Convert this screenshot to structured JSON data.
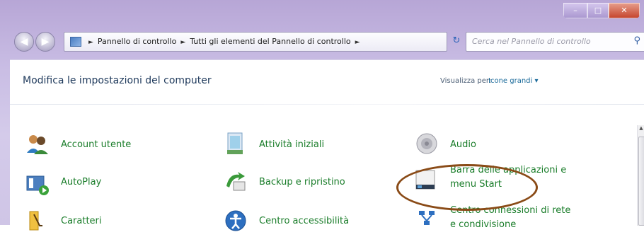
{
  "window": {
    "controls": {
      "min": "–",
      "max": "□",
      "close": "✕"
    }
  },
  "navbar": {
    "back": "◀",
    "forward": "▶",
    "breadcrumb": [
      "Pannello di controllo",
      "Tutti gli elementi del Pannello di controllo"
    ],
    "search_placeholder": "Cerca nel Pannello di controllo",
    "refresh_icon": "refresh-icon"
  },
  "header": {
    "title": "Modifica le impostazioni del computer",
    "view_label": "Visualizza per:",
    "view_value": "Icone grandi ▾"
  },
  "items": [
    {
      "label": "Account utente"
    },
    {
      "label": "Attività iniziali"
    },
    {
      "label": "Audio"
    },
    {
      "label": "AutoPlay"
    },
    {
      "label": "Backup e ripristino"
    },
    {
      "label": "Barra delle applicazioni e"
    },
    {
      "label": "menu Start"
    },
    {
      "label": "Caratteri"
    },
    {
      "label": "Centro accessibilità"
    },
    {
      "label": "Centro connessioni di rete"
    },
    {
      "label": "e condivisione"
    }
  ],
  "colors": {
    "annotation": "#8a4b17",
    "link_green": "#1a7d2a"
  }
}
